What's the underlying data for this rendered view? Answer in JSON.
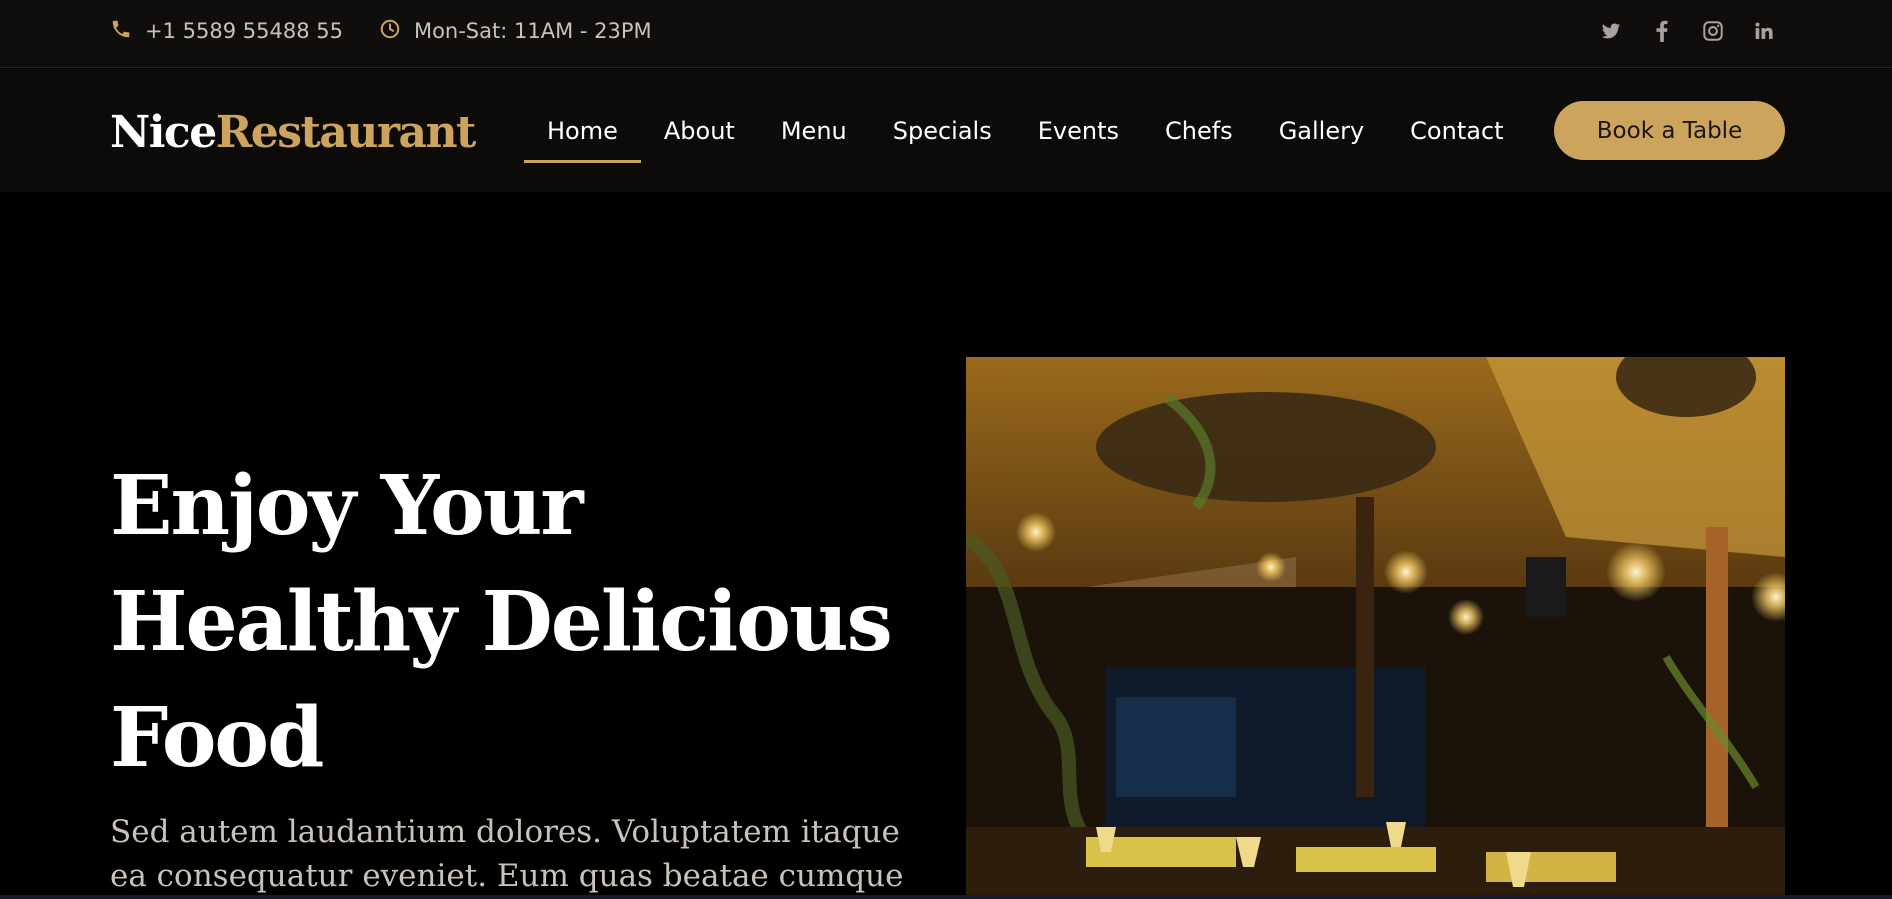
{
  "topbar": {
    "phone": "+1 5589 55488 55",
    "hours": "Mon-Sat: 11AM - 23PM",
    "social": [
      "twitter-icon",
      "facebook-icon",
      "instagram-icon",
      "linkedin-icon"
    ]
  },
  "header": {
    "logo_part1": "Nice",
    "logo_part2": "Restaurant",
    "nav": [
      {
        "label": "Home",
        "active": true
      },
      {
        "label": "About"
      },
      {
        "label": "Menu"
      },
      {
        "label": "Specials"
      },
      {
        "label": "Events"
      },
      {
        "label": "Chefs"
      },
      {
        "label": "Gallery"
      },
      {
        "label": "Contact"
      }
    ],
    "cta": "Book a Table"
  },
  "hero": {
    "title_lines": [
      "Enjoy Your",
      "Healthy Delicious",
      "Food"
    ],
    "subtitle_lines": [
      "Sed autem laudantium dolores. Voluptatem itaque",
      "ea consequatur eveniet. Eum quas beatae cumque"
    ]
  },
  "colors": {
    "accent": "#cda45e",
    "background": "#000000",
    "topbar": "#0f0e0d",
    "text_muted": "#c9c2b8"
  }
}
